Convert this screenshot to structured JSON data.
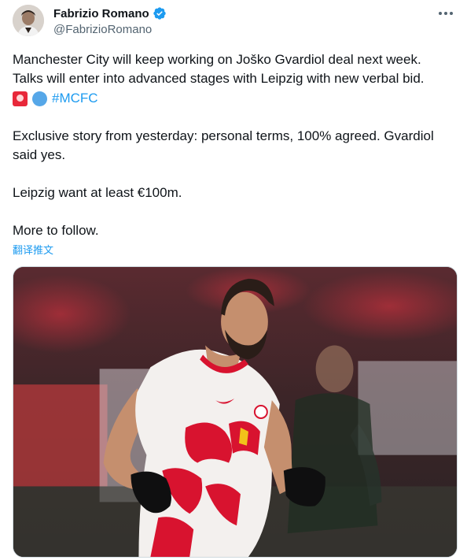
{
  "author": {
    "display_name": "Fabrizio Romano",
    "handle": "@FabrizioRomano",
    "verified_icon": "verified-badge-icon"
  },
  "tweet": {
    "line1": "Manchester City will keep working on Joško Gvardiol deal next week.",
    "line2": "Talks will enter into advanced stages with Leipzig with new verbal bid.",
    "emojis": [
      "siren-emoji",
      "blue-circle-emoji"
    ],
    "hashtag": "#MCFC",
    "para2": "Exclusive story from yesterday: personal terms, 100% agreed. Gvardiol said yes.",
    "para3": "Leipzig want at least €100m.",
    "para4": "More to follow."
  },
  "translate_label": "翻译推文",
  "media": {
    "description_icon": "photo-football-player",
    "colors": {
      "shirt": "#f3f0ee",
      "accent": "#d8132f",
      "crowd": "#6b2730"
    }
  },
  "colors": {
    "link": "#1d9bf0",
    "muted": "#536471",
    "text": "#0f1419"
  }
}
